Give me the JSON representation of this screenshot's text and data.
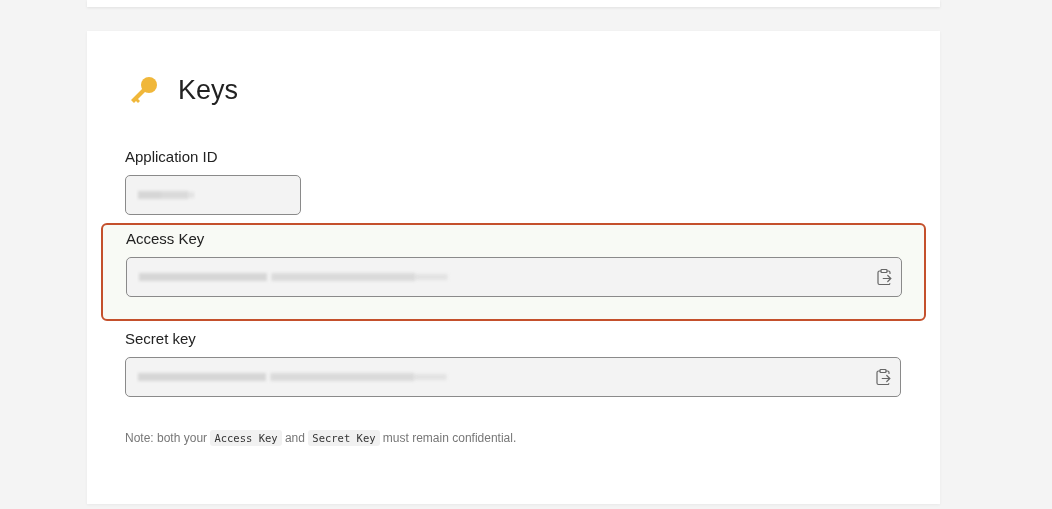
{
  "section": {
    "title": "Keys"
  },
  "fields": [
    {
      "label": "Application ID",
      "kind": "short",
      "highlighted": false,
      "copyable": false
    },
    {
      "label": "Access Key",
      "kind": "wide",
      "highlighted": true,
      "copyable": true
    },
    {
      "label": "Secret key",
      "kind": "wide",
      "highlighted": false,
      "copyable": true
    }
  ],
  "note": [
    {
      "kind": "text",
      "text": "Note: both your "
    },
    {
      "kind": "code",
      "text": "Access Key"
    },
    {
      "kind": "text",
      "text": " and "
    },
    {
      "kind": "code",
      "text": "Secret Key"
    },
    {
      "kind": "text",
      "text": " must remain confidential."
    }
  ]
}
